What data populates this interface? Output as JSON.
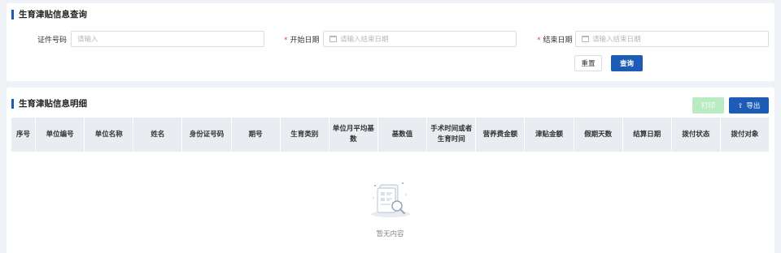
{
  "query_panel": {
    "title": "生育津贴信息查询",
    "id_number_label": "证件号码",
    "id_number_placeholder": "请输入",
    "start_date_label": "开始日期",
    "start_date_placeholder": "请输入结束日期",
    "end_date_label": "结束日期",
    "end_date_placeholder": "请输入结束日期",
    "reset_label": "重置",
    "query_label": "查询",
    "required_mark": "*"
  },
  "detail_panel": {
    "title": "生育津贴信息明细",
    "print_label": "打印",
    "export_label": "导出",
    "export_icon": "upload-icon",
    "columns": [
      "序号",
      "单位编号",
      "单位名称",
      "姓名",
      "身份证号码",
      "期号",
      "生育类别",
      "单位月平均基数",
      "基数值",
      "手术时间或者生育时间",
      "营养费金额",
      "津贴金额",
      "假期天数",
      "结算日期",
      "拨付状态",
      "拨付对象"
    ],
    "empty_text": "暂无内容",
    "empty_icon": "empty-document-search-icon"
  },
  "colors": {
    "primary": "#1c5cb5",
    "print_disabled": "#b9ecc3",
    "required": "#e34a4a",
    "header_bg": "#e9ecf0",
    "page_bg": "#eef1f5"
  }
}
